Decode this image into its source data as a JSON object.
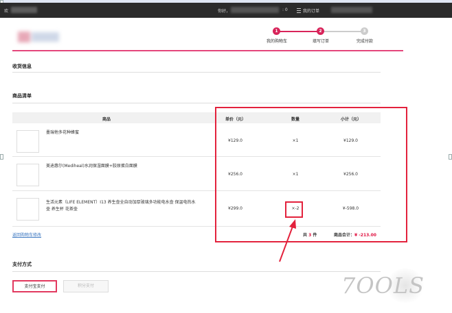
{
  "topbar": {
    "welcome": "欢",
    "hello": "你好，",
    "count": ": 0",
    "orders": "我的订单"
  },
  "steps": [
    {
      "num": "1",
      "label": "我的购物车"
    },
    {
      "num": "2",
      "label": "填写订单"
    },
    {
      "num": "3",
      "label": "完成付款"
    }
  ],
  "sections": {
    "shipping": "收货信息",
    "items": "商品清单",
    "payment": "支付方式"
  },
  "table": {
    "headers": {
      "product": "商品",
      "price": "单价（元）",
      "qty": "数量",
      "subtotal": "小计（元）"
    },
    "rows": [
      {
        "name": "墨瑞他多花种蜂蜜",
        "price": "¥129.0",
        "qty": "×1",
        "subtotal": "¥129.0"
      },
      {
        "name": "美迪惠尔(Mediheal)水润保湿面膜+胶原蛋白面膜",
        "price": "¥256.0",
        "qty": "×1",
        "subtotal": "¥256.0"
      },
      {
        "name": "生活元素（LIFE ELEMENT）I13 养生壶全自动加厚玻璃多功能电水壶 保温电热水壶 养生杯 花茶壶",
        "price": "¥299.0",
        "qty": "×-2",
        "subtotal": "¥-598.0"
      }
    ]
  },
  "footer": {
    "back_link": "返回购物车修改",
    "count_prefix": "共",
    "count_value": "3",
    "count_suffix": "件",
    "total_label": "商品合计：",
    "total_value": "¥ -213.00"
  },
  "payment": {
    "alipay": "支付宝支付",
    "points": "积分支付"
  },
  "watermark": "7OOLS",
  "colors": {
    "brand": "#e4457b",
    "highlight": "#e3213c",
    "step_active": "#d8245a",
    "step_inactive": "#cccccc",
    "price_red": "#e0103f"
  }
}
